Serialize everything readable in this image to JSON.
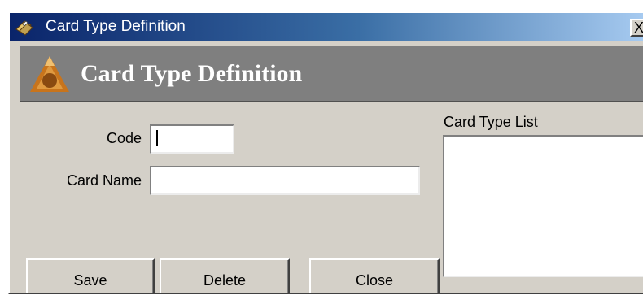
{
  "window": {
    "title": "Card Type Definition",
    "close_label": "X",
    "icon": "card-stack-icon"
  },
  "banner": {
    "title": "Card Type Definition",
    "logo": "triangle-logo"
  },
  "form": {
    "code_label": "Code",
    "code_value": "",
    "card_name_label": "Card Name",
    "card_name_value": ""
  },
  "list": {
    "label": "Card Type List",
    "items": []
  },
  "buttons": {
    "save": "Save",
    "delete": "Delete",
    "close": "Close"
  },
  "colors": {
    "titlebar_start": "#0a246a",
    "titlebar_end": "#a6caf0",
    "face": "#d4d0c8",
    "banner": "#7f7f7f",
    "logo_orange": "#c8741c"
  }
}
